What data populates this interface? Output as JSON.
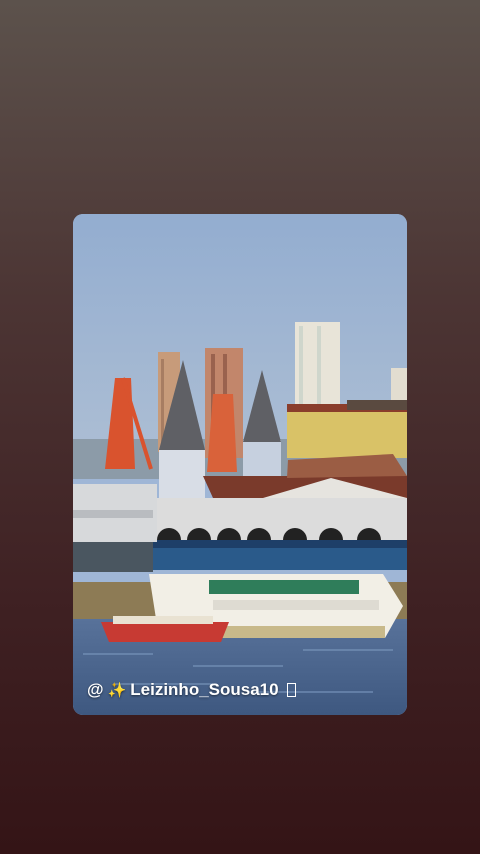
{
  "story": {
    "caption": {
      "at_symbol": "@",
      "sparkle_icon": "✨",
      "username": "Leizinho_Sousa10",
      "trailing_glyph": "missing-glyph-box"
    },
    "photo_subject": "harbor-with-boats-and-market-hall"
  },
  "colors": {
    "background_top": "#5c524c",
    "background_bottom": "#341416",
    "sky": "#9fb6d6",
    "water": "#4a6689"
  }
}
